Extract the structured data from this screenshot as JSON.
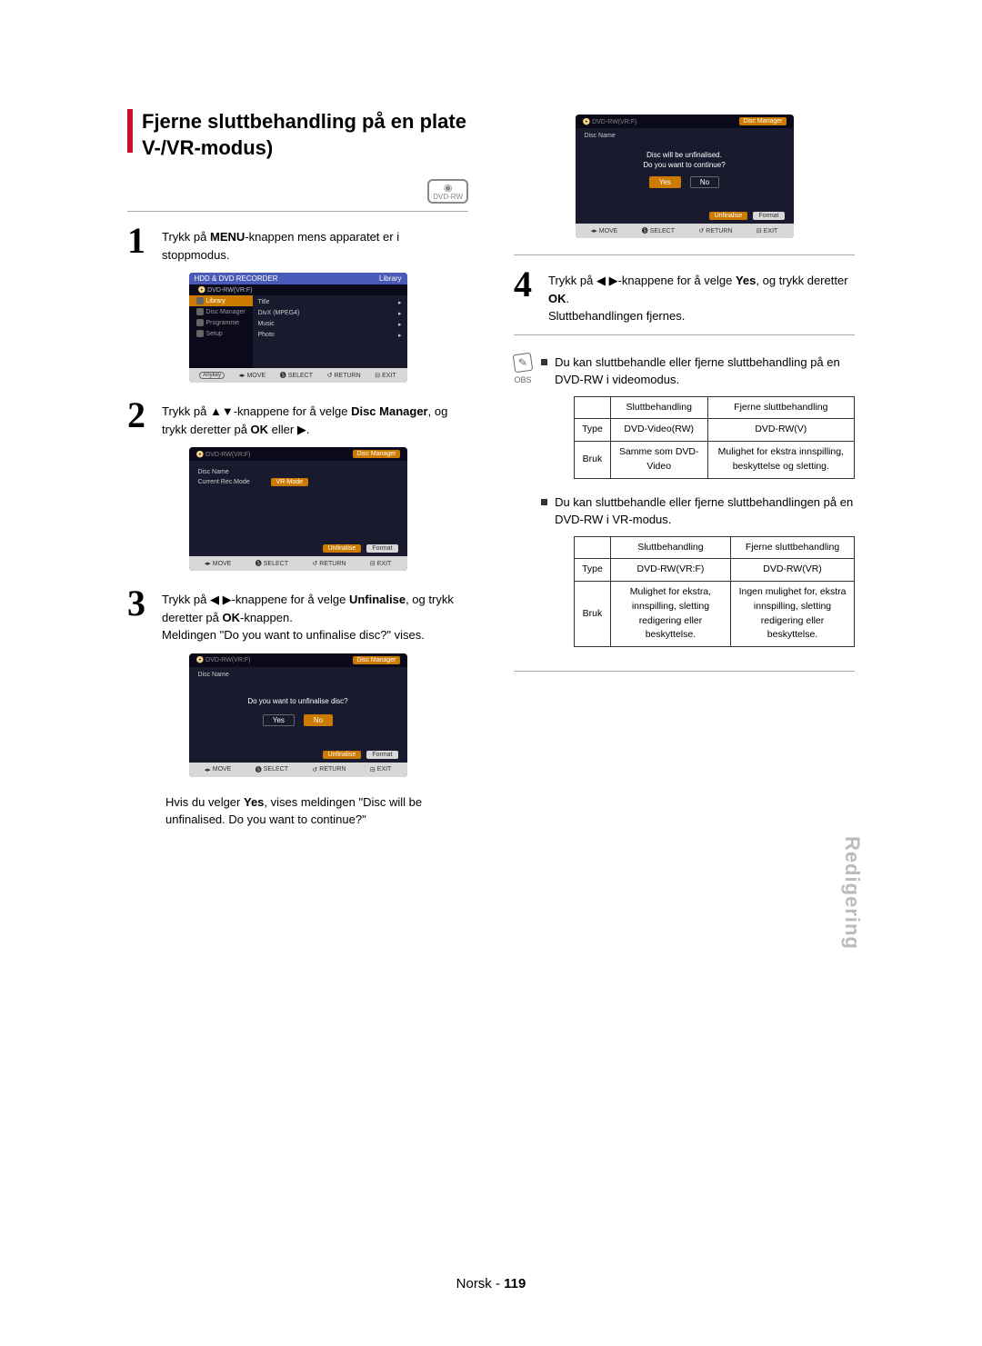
{
  "section_title": "Fjerne sluttbehandling på en plate V-/VR-modus)",
  "disc_badge": "DVD-RW",
  "steps": {
    "s1": {
      "text_pre": "Trykk på ",
      "bold1": "MENU",
      "text_post": "-knappen mens apparatet er i stoppmodus."
    },
    "s2": {
      "text_pre": "Trykk på ▲▼-knappene for å velge ",
      "bold1": "Disc Manager",
      "text_mid": ", og trykk deretter på ",
      "bold2": "OK",
      "text_post": " eller ▶."
    },
    "s3": {
      "text_pre": "Trykk på ◀ ▶-knappene for å velge ",
      "bold1": "Unfinalise",
      "text_mid": ", og trykk deretter på ",
      "bold2": "OK",
      "text_post": "-knappen.",
      "extra": "Meldingen \"Do you want to unfinalise disc?\" vises."
    },
    "s3_followup": {
      "pre": "Hvis du velger ",
      "bold": "Yes",
      "post": ", vises meldingen \"Disc will be unfinalised. Do you want to continue?\""
    },
    "s4": {
      "text_pre": "Trykk på ◀ ▶-knappene for å velge ",
      "bold1": "Yes",
      "text_mid": ", og trykk deretter ",
      "bold2": "OK",
      "text_post": ".",
      "extra": "Sluttbehandlingen fjernes."
    }
  },
  "screen1": {
    "header_left": "HDD & DVD RECORDER",
    "header_right": "Library",
    "sub": "DVD-RW(VR:F)",
    "left_items": [
      "Library",
      "Disc Manager",
      "Programme",
      "Setup"
    ],
    "right_items": [
      "Title",
      "DivX (MPEG4)",
      "Music",
      "Photo"
    ]
  },
  "screen2": {
    "sub": "DVD-RW(VR:F)",
    "dm": "Disc Manager",
    "rows": {
      "name": "Disc Name",
      "mode_lbl": "Current Rec.Mode",
      "mode_val": "VR-Mode"
    },
    "btn1": "Unfinalise",
    "btn2": "Format"
  },
  "screen3": {
    "msg": "Do you want to unfinalise disc?",
    "yes": "Yes",
    "no": "No"
  },
  "screen4": {
    "msg1": "Disc will be unfinalised.",
    "msg2": "Do you want to continue?"
  },
  "footer_bar": {
    "anykey": "Anykey",
    "move": "MOVE",
    "select": "SELECT",
    "return": "RETURN",
    "exit": "EXIT"
  },
  "obs_label": "OBS",
  "note1": "Du kan sluttbehandle eller fjerne sluttbehandling på en DVD-RW i videomodus.",
  "note2": "Du kan sluttbehandle eller fjerne sluttbehandlingen på en DVD-RW i VR-modus.",
  "table1": {
    "h1": "Sluttbehandling",
    "h2": "Fjerne sluttbehandling",
    "r1c0": "Type",
    "r1c1": "DVD-Video(RW)",
    "r1c2": "DVD-RW(V)",
    "r2c0": "Bruk",
    "r2c1": "Samme som DVD-Video",
    "r2c2": "Mulighet for ekstra innspilling, beskyttelse og sletting."
  },
  "table2": {
    "h1": "Sluttbehandling",
    "h2": "Fjerne sluttbehandling",
    "r1c0": "Type",
    "r1c1": "DVD-RW(VR:F)",
    "r1c2": "DVD-RW(VR)",
    "r2c0": "Bruk",
    "r2c1": "Mulighet for ekstra, innspilling, sletting redigering eller beskyttelse.",
    "r2c2": "Ingen mulighet for, ekstra innspilling, sletting redigering eller beskyttelse."
  },
  "side_tab": "Redigering",
  "page_footer": {
    "lang": "Norsk",
    "sep": " - ",
    "num": "119"
  }
}
